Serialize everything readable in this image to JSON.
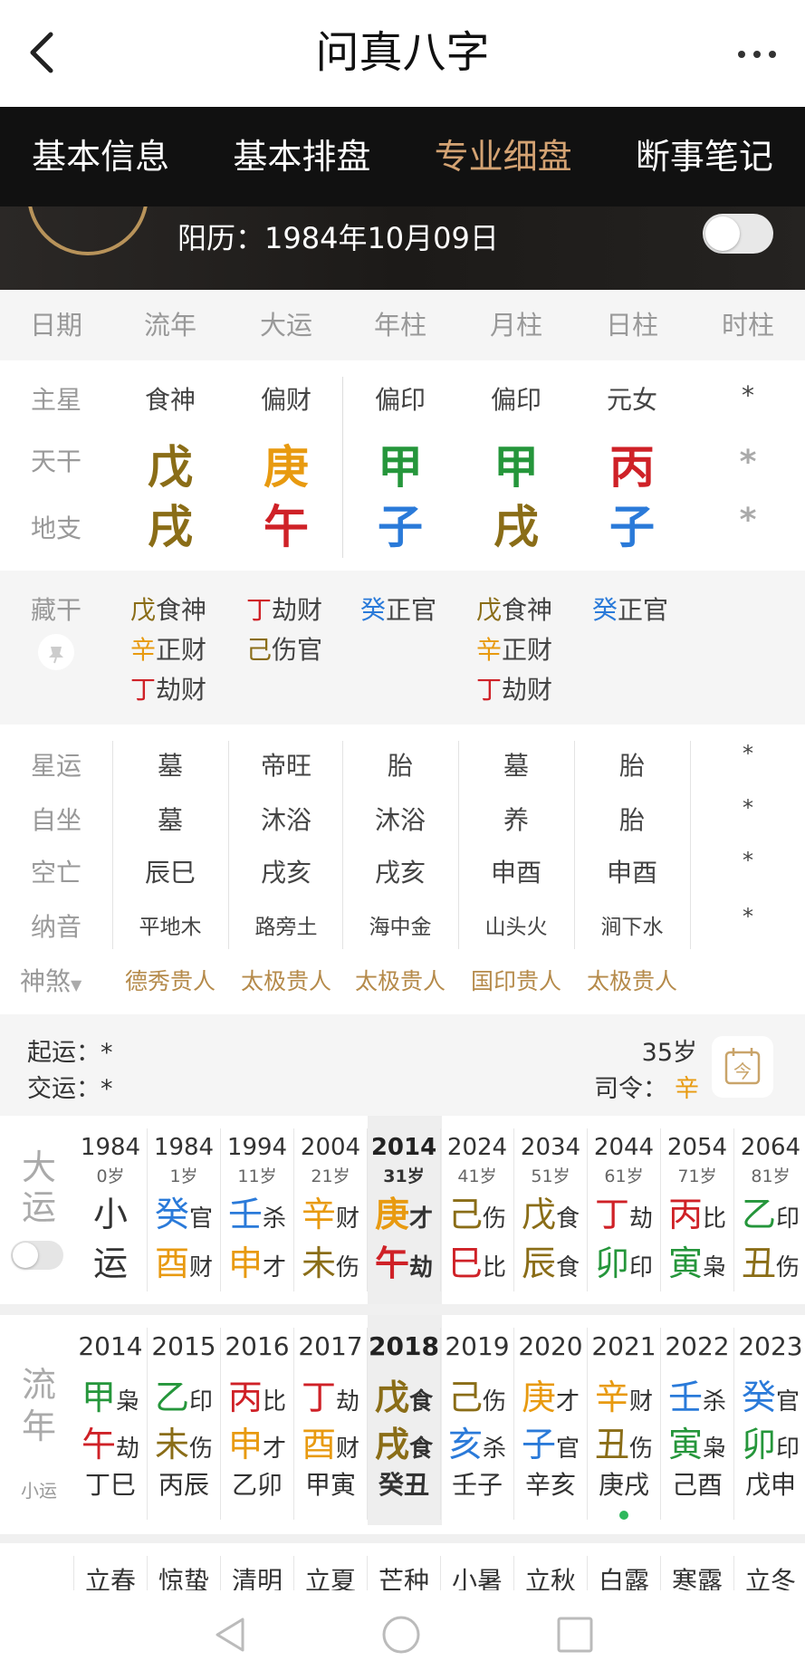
{
  "app": {
    "title": "问真八字"
  },
  "tabs": [
    "基本信息",
    "基本排盘",
    "专业细盘",
    "断事笔记"
  ],
  "banner": {
    "solar_date": "阳历：1984年10月09日"
  },
  "columns": [
    "日期",
    "流年",
    "大运",
    "年柱",
    "月柱",
    "日柱",
    "时柱"
  ],
  "rows": {
    "zhuxing": {
      "label": "主星",
      "values": [
        "食神",
        "偏财",
        "偏印",
        "偏印",
        "元女",
        "*"
      ]
    },
    "tiangan": {
      "label": "天干",
      "values": [
        "戊",
        "庚",
        "甲",
        "甲",
        "丙",
        "*"
      ]
    },
    "dizhi": {
      "label": "地支",
      "values": [
        "戌",
        "午",
        "子",
        "戌",
        "子",
        "*"
      ]
    }
  },
  "canggan": {
    "label": "藏干",
    "cols": [
      [
        [
          "戊",
          "食神"
        ],
        [
          "辛",
          "正财"
        ],
        [
          "丁",
          "劫财"
        ]
      ],
      [
        [
          "丁",
          "劫财"
        ],
        [
          "己",
          "伤官"
        ]
      ],
      [
        [
          "癸",
          "正官"
        ]
      ],
      [
        [
          "戊",
          "食神"
        ],
        [
          "辛",
          "正财"
        ],
        [
          "丁",
          "劫财"
        ]
      ],
      [
        [
          "癸",
          "正官"
        ]
      ]
    ]
  },
  "xingyun": {
    "label": "星运",
    "values": [
      "墓",
      "帝旺",
      "胎",
      "墓",
      "胎",
      "*"
    ]
  },
  "zizuo": {
    "label": "自坐",
    "values": [
      "墓",
      "沐浴",
      "沐浴",
      "养",
      "胎",
      "*"
    ]
  },
  "kongwang": {
    "label": "空亡",
    "values": [
      "辰巳",
      "戌亥",
      "戌亥",
      "申酉",
      "申酉",
      "*"
    ]
  },
  "nayin": {
    "label": "纳音",
    "values": [
      "平地木",
      "路旁土",
      "海中金",
      "山头火",
      "涧下水",
      "*"
    ]
  },
  "shensha": {
    "label": "神煞",
    "values": [
      "德秀贵人",
      "太极贵人",
      "太极贵人",
      "国印贵人",
      "太极贵人"
    ]
  },
  "qiyun": {
    "qiyun": "起运：*",
    "jiaoyun": "交运：*",
    "age": "35岁",
    "siling_label": "司令：",
    "siling_value": "辛",
    "cal_icon": "今"
  },
  "dayun": {
    "label_top": "大",
    "label_bottom": "运",
    "cols": [
      {
        "year": "1984",
        "age": "0岁",
        "top": "小",
        "top_s": "",
        "bottom": "运",
        "bottom_s": ""
      },
      {
        "year": "1984",
        "age": "1岁",
        "top": "癸",
        "top_s": "官",
        "bottom": "酉",
        "bottom_s": "财"
      },
      {
        "year": "1994",
        "age": "11岁",
        "top": "壬",
        "top_s": "杀",
        "bottom": "申",
        "bottom_s": "才"
      },
      {
        "year": "2004",
        "age": "21岁",
        "top": "辛",
        "top_s": "财",
        "bottom": "未",
        "bottom_s": "伤"
      },
      {
        "year": "2014",
        "age": "31岁",
        "top": "庚",
        "top_s": "才",
        "bottom": "午",
        "bottom_s": "劫"
      },
      {
        "year": "2024",
        "age": "41岁",
        "top": "己",
        "top_s": "伤",
        "bottom": "巳",
        "bottom_s": "比"
      },
      {
        "year": "2034",
        "age": "51岁",
        "top": "戊",
        "top_s": "食",
        "bottom": "辰",
        "bottom_s": "食"
      },
      {
        "year": "2044",
        "age": "61岁",
        "top": "丁",
        "top_s": "劫",
        "bottom": "卯",
        "bottom_s": "印"
      },
      {
        "year": "2054",
        "age": "71岁",
        "top": "丙",
        "top_s": "比",
        "bottom": "寅",
        "bottom_s": "枭"
      },
      {
        "year": "2064",
        "age": "81岁",
        "top": "乙",
        "top_s": "印",
        "bottom": "丑",
        "bottom_s": "伤"
      }
    ]
  },
  "liunian": {
    "label_top": "流",
    "label_bottom": "年",
    "label_small": "小运",
    "cols": [
      {
        "year": "2014",
        "top": "甲",
        "top_s": "枭",
        "bottom": "午",
        "bottom_s": "劫",
        "xiaoyun": "丁巳"
      },
      {
        "year": "2015",
        "top": "乙",
        "top_s": "印",
        "bottom": "未",
        "bottom_s": "伤",
        "xiaoyun": "丙辰"
      },
      {
        "year": "2016",
        "top": "丙",
        "top_s": "比",
        "bottom": "申",
        "bottom_s": "才",
        "xiaoyun": "乙卯"
      },
      {
        "year": "2017",
        "top": "丁",
        "top_s": "劫",
        "bottom": "酉",
        "bottom_s": "财",
        "xiaoyun": "甲寅"
      },
      {
        "year": "2018",
        "top": "戊",
        "top_s": "食",
        "bottom": "戌",
        "bottom_s": "食",
        "xiaoyun": "癸丑"
      },
      {
        "year": "2019",
        "top": "己",
        "top_s": "伤",
        "bottom": "亥",
        "bottom_s": "杀",
        "xiaoyun": "壬子"
      },
      {
        "year": "2020",
        "top": "庚",
        "top_s": "才",
        "bottom": "子",
        "bottom_s": "官",
        "xiaoyun": "辛亥"
      },
      {
        "year": "2021",
        "top": "辛",
        "top_s": "财",
        "bottom": "丑",
        "bottom_s": "伤",
        "xiaoyun": "庚戌"
      },
      {
        "year": "2022",
        "top": "壬",
        "top_s": "杀",
        "bottom": "寅",
        "bottom_s": "枭",
        "xiaoyun": "己酉"
      },
      {
        "year": "2023",
        "top": "癸",
        "top_s": "官",
        "bottom": "卯",
        "bottom_s": "印",
        "xiaoyun": "戊申"
      }
    ]
  },
  "jieqi": [
    "立春",
    "惊蛰",
    "清明",
    "立夏",
    "芒种",
    "小暑",
    "立秋",
    "白露",
    "寒露",
    "立冬"
  ],
  "element_colors": {
    "甲": "#25963b",
    "乙": "#25963b",
    "寅": "#25963b",
    "卯": "#25963b",
    "丙": "#cf2127",
    "丁": "#cf2127",
    "巳": "#cf2127",
    "午": "#cf2127",
    "戊": "#8a6d17",
    "己": "#8a6d17",
    "辰": "#8a6d17",
    "戌": "#8a6d17",
    "丑": "#8a6d17",
    "未": "#8a6d17",
    "庚": "#e89a10",
    "辛": "#e89a10",
    "申": "#e89a10",
    "酉": "#e89a10",
    "壬": "#2a7ad9",
    "癸": "#2a7ad9",
    "亥": "#2a7ad9",
    "子": "#2a7ad9"
  },
  "highlight_color": "#b58a4a"
}
